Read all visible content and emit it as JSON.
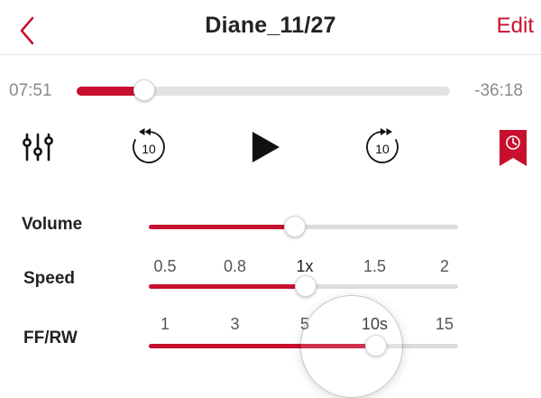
{
  "header": {
    "title": "Diane_11/27",
    "edit_label": "Edit",
    "back_icon": "chevron-left-icon",
    "accent_color": "#c8102e"
  },
  "progress": {
    "elapsed": "07:51",
    "remaining": "-36:18",
    "fraction": 0.18
  },
  "controls": {
    "equalizer_icon": "equalizer-icon",
    "rewind": {
      "icon": "rewind-icon",
      "label": "10"
    },
    "play_icon": "play-icon",
    "fast_forward": {
      "icon": "fast-forward-icon",
      "label": "10"
    },
    "bookmark_icon": "bookmark-clock-icon"
  },
  "settings": {
    "volume": {
      "label": "Volume",
      "fraction": 0.47
    },
    "speed": {
      "label": "Speed",
      "ticks": [
        "0.5",
        "0.8",
        "1x",
        "1.5",
        "2"
      ],
      "selected_index": 2
    },
    "ffrw": {
      "label": "FF/RW",
      "ticks": [
        "1",
        "3",
        "5",
        "10s",
        "15"
      ],
      "selected_index": 3
    }
  }
}
